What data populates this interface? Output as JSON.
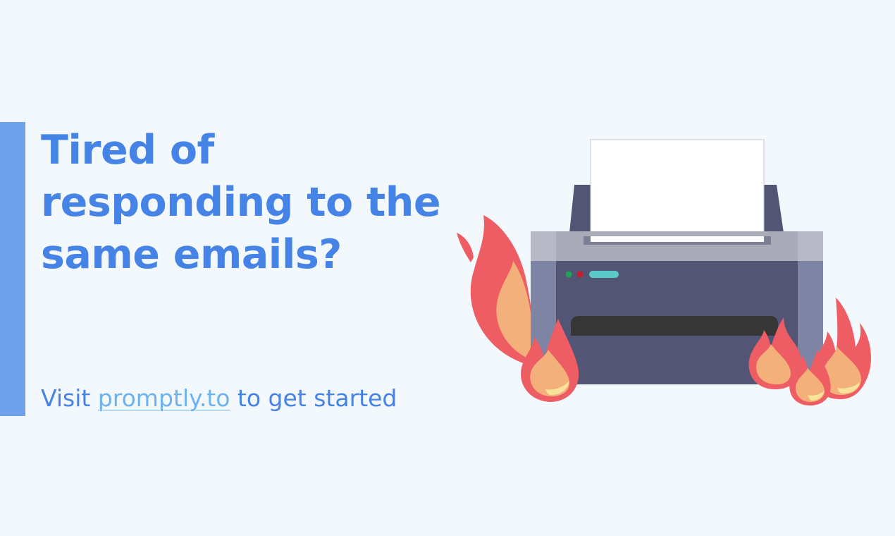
{
  "headline": {
    "line1": "Tired of",
    "line2": "responding to the",
    "line3": "same emails?"
  },
  "cta": {
    "prefix": "Visit ",
    "link_text": "promptly.to",
    "suffix": " to get started"
  },
  "illustration": {
    "icon": "burning-printer-icon"
  },
  "colors": {
    "background": "#f3f8fc",
    "accent_bar": "#6fa1ec",
    "headline": "#4683e6",
    "link": "#6fb2f0",
    "printer_body": "#525573",
    "printer_top": "#a9acb8",
    "flame_outer": "#ef5d64",
    "flame_inner": "#f4b07a",
    "flame_core": "#f7e49a"
  }
}
